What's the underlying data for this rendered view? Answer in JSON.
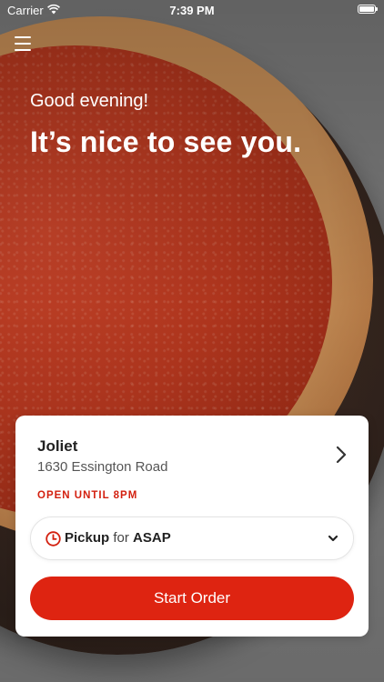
{
  "status_bar": {
    "carrier": "Carrier",
    "time": "7:39 PM"
  },
  "hero": {
    "greeting": "Good evening!",
    "headline": "It’s nice to see you."
  },
  "location": {
    "name": "Joliet",
    "address": "1630 Essington Road",
    "hours": "OPEN UNTIL 8PM"
  },
  "order_mode": {
    "mode": "Pickup",
    "connector": "for",
    "time": "ASAP"
  },
  "actions": {
    "start_order": "Start Order"
  },
  "colors": {
    "accent": "#de2411",
    "hours_text": "#d3200f"
  },
  "icons": {
    "menu": "hamburger-menu-icon",
    "chevron": "chevron-right-icon",
    "clock": "clock-icon",
    "dropdown": "chevron-down-icon",
    "wifi": "wifi-icon",
    "battery": "battery-icon"
  }
}
